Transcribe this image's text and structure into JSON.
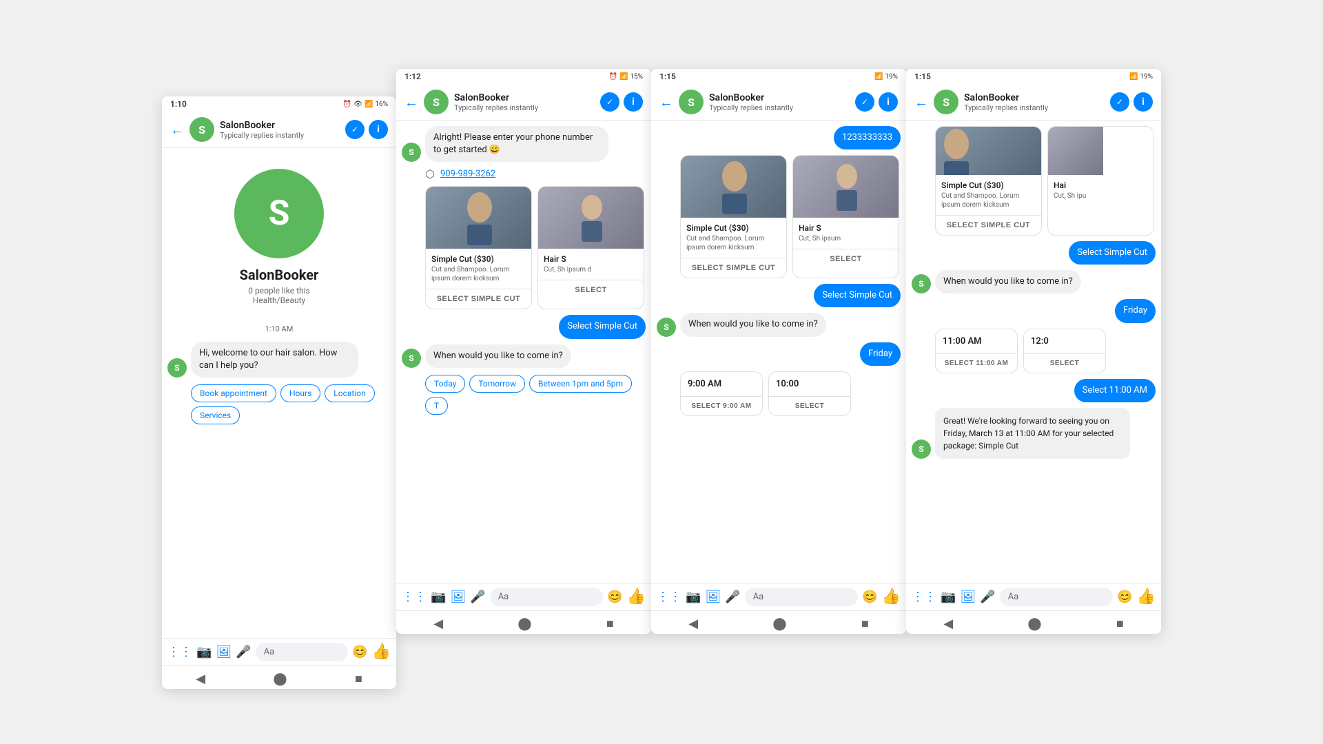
{
  "screens": [
    {
      "id": "screen1",
      "status_bar": {
        "time": "1:10",
        "battery": "16%"
      },
      "nav": {
        "back": "←",
        "name": "SalonBooker",
        "subtitle": "Typically replies instantly"
      },
      "profile": {
        "initial": "S",
        "name": "SalonBooker",
        "likes": "0 people like this",
        "category": "Health/Beauty"
      },
      "messages": [
        {
          "type": "received",
          "text": "Hi, welcome to our hair salon. How can I help you?",
          "time": "1:10 AM"
        }
      ],
      "quick_replies": [
        "Book appointment",
        "Hours",
        "Location",
        "Services"
      ],
      "input_placeholder": "Aa"
    },
    {
      "id": "screen2",
      "status_bar": {
        "time": "1:12",
        "battery": "15%"
      },
      "nav": {
        "name": "SalonBooker",
        "subtitle": "Typically replies instantly"
      },
      "messages": [
        {
          "type": "received",
          "text": "Alright! Please enter your phone number to get started 😀"
        },
        {
          "type": "share",
          "phone": "909-989-3262"
        },
        {
          "type": "cards",
          "items": [
            {
              "title": "Simple Cut ($30)",
              "desc": "Cut and Shampoo. Lorum ipsum dorem kicksum",
              "btn": "SELECT SIMPLE CUT"
            },
            {
              "title": "Hair S",
              "desc": "Cut, Sh ipsum d",
              "btn": "SELECT"
            }
          ]
        },
        {
          "type": "sent",
          "text": "Select Simple Cut"
        },
        {
          "type": "received",
          "text": "When would you like to come in?"
        },
        {
          "type": "quick_replies",
          "items": [
            "Today",
            "Tomorrow",
            "Between 1pm and 5pm",
            "T"
          ]
        }
      ],
      "input_placeholder": "Aa"
    },
    {
      "id": "screen3",
      "status_bar": {
        "time": "1:15",
        "battery": "19%"
      },
      "nav": {
        "name": "SalonBooker",
        "subtitle": "Typically replies instantly"
      },
      "messages": [
        {
          "type": "top_bubble",
          "text": "1233333333"
        },
        {
          "type": "cards",
          "items": [
            {
              "title": "Simple Cut ($30)",
              "desc": "Cut and Shampoo. Lorum ipsum dorem kicksum",
              "btn": "SELECT SIMPLE CUT"
            },
            {
              "title": "Hair S",
              "desc": "Cut, Sh ipsum",
              "btn": "SELECT"
            }
          ]
        },
        {
          "type": "sent",
          "text": "Select Simple Cut"
        },
        {
          "type": "received",
          "text": "When would you like to come in?"
        },
        {
          "type": "sent_pill",
          "text": "Friday"
        },
        {
          "type": "time_cards",
          "items": [
            {
              "time": "9:00 AM",
              "btn": "SELECT 9:00 AM"
            },
            {
              "time": "10:00",
              "btn": "SELECT"
            }
          ]
        }
      ],
      "input_placeholder": "Aa"
    },
    {
      "id": "screen4",
      "status_bar": {
        "time": "1:15",
        "battery": "19%"
      },
      "nav": {
        "name": "SalonBooker",
        "subtitle": "Typically replies instantly"
      },
      "messages": [
        {
          "type": "cards",
          "items": [
            {
              "title": "Simple Cut ($30)",
              "desc": "Cut and Shampoo. Lorum ipsum dorem kicksum",
              "btn": "SELECT SIMPLE CUT"
            },
            {
              "title": "Hai",
              "desc": "Cut, Sh ipu",
              "btn": ""
            }
          ]
        },
        {
          "type": "sent",
          "text": "Select Simple Cut"
        },
        {
          "type": "received",
          "text": "When would you like to come in?"
        },
        {
          "type": "sent_pill",
          "text": "Friday"
        },
        {
          "type": "time_cards",
          "items": [
            {
              "time": "11:00 AM",
              "btn": "SELECT 11:00 AM"
            },
            {
              "time": "12:0",
              "btn": ""
            }
          ]
        },
        {
          "type": "sent",
          "text": "Select 11:00 AM"
        },
        {
          "type": "received_confirm",
          "text": "Great! We're looking forward to seeing you on Friday, March 13 at 11:00 AM for your selected package: Simple Cut"
        }
      ],
      "input_placeholder": "Aa"
    }
  ]
}
